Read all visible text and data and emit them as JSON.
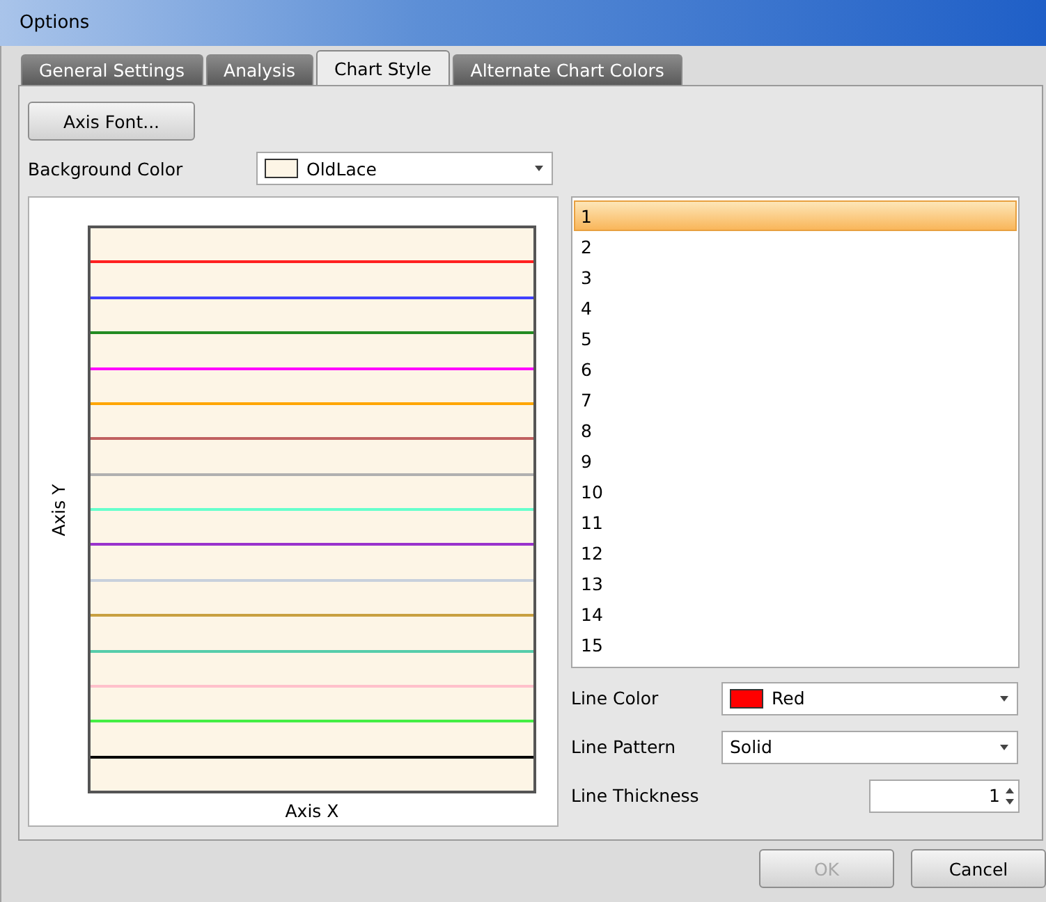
{
  "window": {
    "title": "Options"
  },
  "tabs": [
    {
      "label": "General Settings",
      "selected": false
    },
    {
      "label": "Analysis",
      "selected": false
    },
    {
      "label": "Chart Style",
      "selected": true
    },
    {
      "label": "Alternate Chart Colors",
      "selected": false
    }
  ],
  "axis_font_button": "Axis Font...",
  "background_color": {
    "label": "Background Color",
    "value": "OldLace",
    "color": "#fdf5e6"
  },
  "preview": {
    "x_label": "Axis X",
    "y_label": "Axis Y",
    "lines": [
      {
        "color": "#ff2020"
      },
      {
        "color": "#4040ff"
      },
      {
        "color": "#228b22"
      },
      {
        "color": "#ff00ff"
      },
      {
        "color": "#ffa500"
      },
      {
        "color": "#c06060"
      },
      {
        "color": "#b0b0b0"
      },
      {
        "color": "#66ffcc"
      },
      {
        "color": "#9932cc"
      },
      {
        "color": "#c8d0dc"
      },
      {
        "color": "#c8a040"
      },
      {
        "color": "#55ccaa"
      },
      {
        "color": "#ffc0cb"
      },
      {
        "color": "#44ee44"
      },
      {
        "color": "#000000"
      }
    ]
  },
  "line_list": [
    {
      "label": "1",
      "selected": true
    },
    {
      "label": "2",
      "selected": false
    },
    {
      "label": "3",
      "selected": false
    },
    {
      "label": "4",
      "selected": false
    },
    {
      "label": "5",
      "selected": false
    },
    {
      "label": "6",
      "selected": false
    },
    {
      "label": "7",
      "selected": false
    },
    {
      "label": "8",
      "selected": false
    },
    {
      "label": "9",
      "selected": false
    },
    {
      "label": "10",
      "selected": false
    },
    {
      "label": "11",
      "selected": false
    },
    {
      "label": "12",
      "selected": false
    },
    {
      "label": "13",
      "selected": false
    },
    {
      "label": "14",
      "selected": false
    },
    {
      "label": "15",
      "selected": false
    }
  ],
  "line_color": {
    "label": "Line Color",
    "value": "Red",
    "color": "#ff0000"
  },
  "line_pattern": {
    "label": "Line Pattern",
    "value": "Solid"
  },
  "line_thickness": {
    "label": "Line Thickness",
    "value": "1"
  },
  "buttons": [
    {
      "label": "OK",
      "disabled": true
    },
    {
      "label": "Cancel",
      "disabled": false
    }
  ]
}
